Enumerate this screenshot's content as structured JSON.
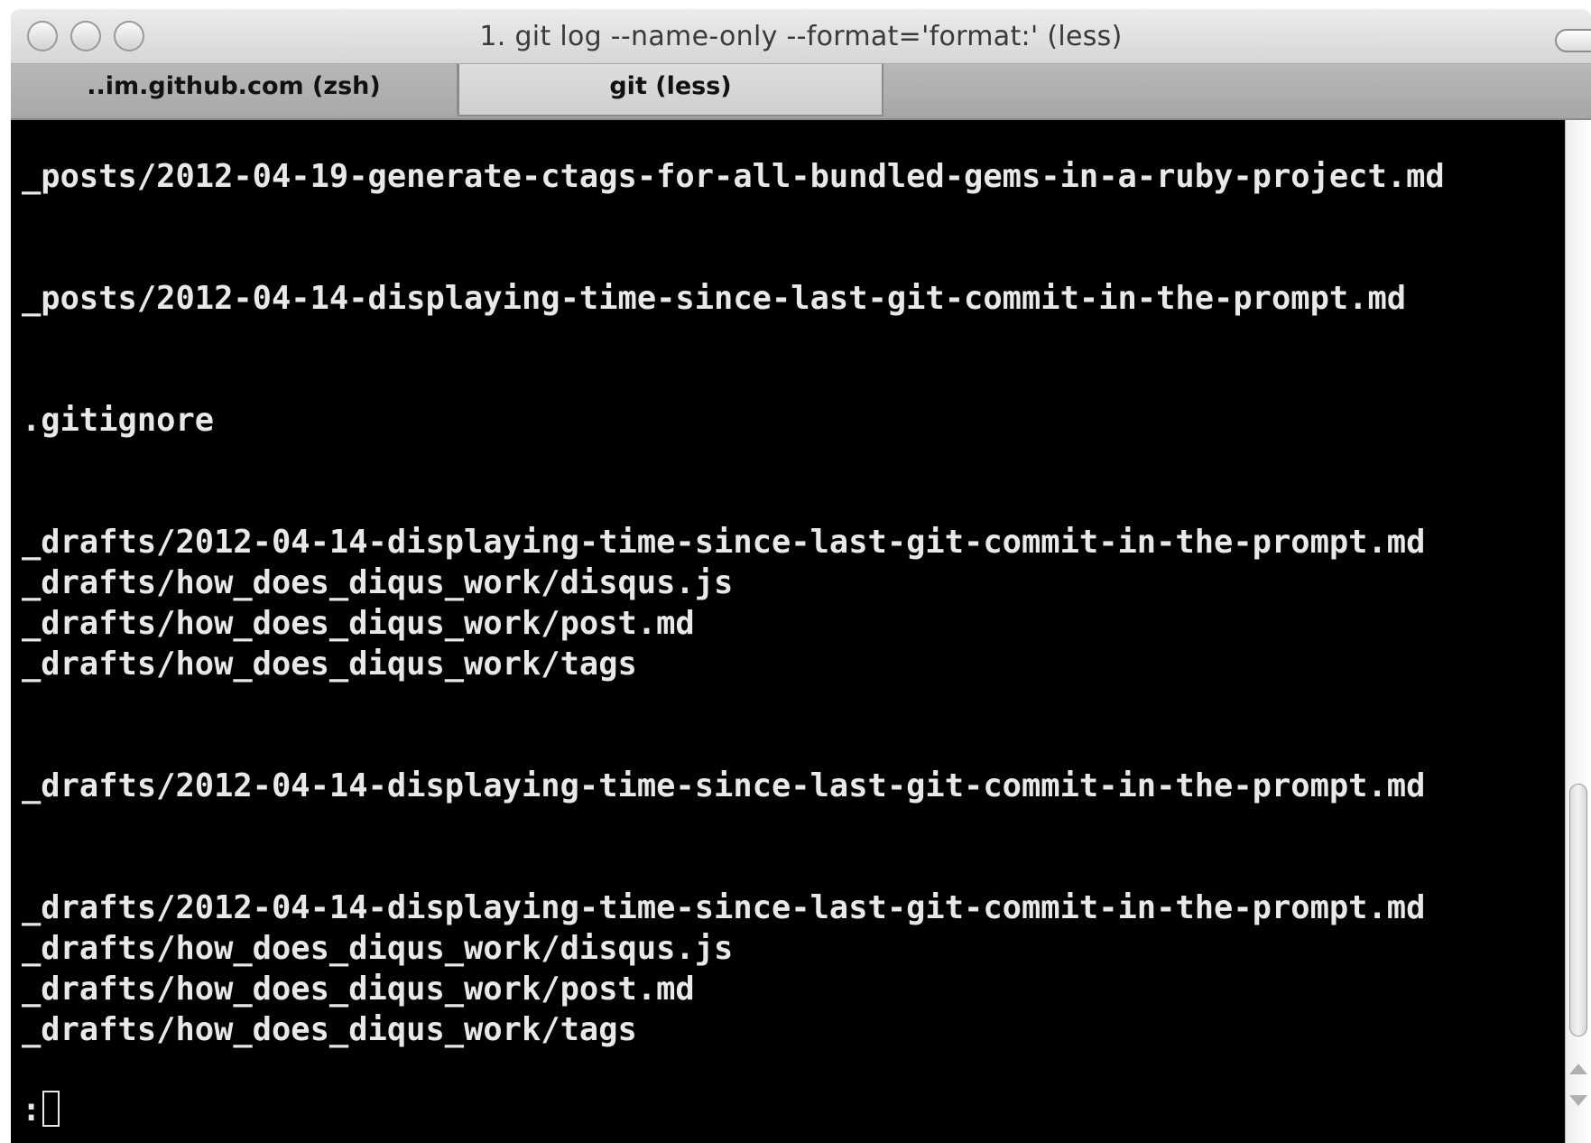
{
  "window": {
    "title": "1. git log --name-only --format='format:' (less)"
  },
  "tabs": [
    {
      "label": "..im.github.com (zsh)"
    },
    {
      "label": "git (less)"
    }
  ],
  "terminal": {
    "lines": [
      "_posts/2012-04-19-generate-ctags-for-all-bundled-gems-in-a-ruby-project.md",
      "",
      "",
      "_posts/2012-04-14-displaying-time-since-last-git-commit-in-the-prompt.md",
      "",
      "",
      ".gitignore",
      "",
      "",
      "_drafts/2012-04-14-displaying-time-since-last-git-commit-in-the-prompt.md",
      "_drafts/how_does_diqus_work/disqus.js",
      "_drafts/how_does_diqus_work/post.md",
      "_drafts/how_does_diqus_work/tags",
      "",
      "",
      "_drafts/2012-04-14-displaying-time-since-last-git-commit-in-the-prompt.md",
      "",
      "",
      "_drafts/2012-04-14-displaying-time-since-last-git-commit-in-the-prompt.md",
      "_drafts/how_does_diqus_work/disqus.js",
      "_drafts/how_does_diqus_work/post.md",
      "_drafts/how_does_diqus_work/tags"
    ],
    "prompt": ":"
  },
  "colors": {
    "terminal_bg": "#000000",
    "terminal_fg": "#e8e8e8"
  }
}
